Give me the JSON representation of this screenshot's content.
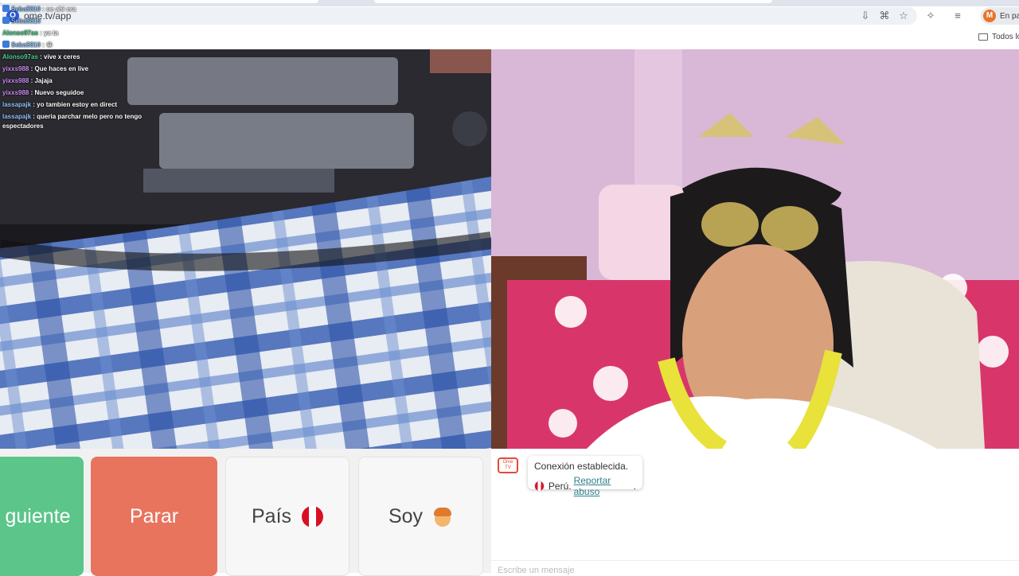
{
  "browser": {
    "url": "ome.tv/app",
    "profile_initial": "M",
    "profile_label": "En pau",
    "bookmarks_all": "Todos lo"
  },
  "stream_chat": [
    {
      "user": "Seba5810",
      "text": "oe ahi era",
      "user_color": "#5aa9ff"
    },
    {
      "user": "Seba5810",
      "text": "",
      "user_color": "#5aa9ff"
    },
    {
      "user": "Alonso97as",
      "text": "ya ta",
      "user_color": "#4fd38b"
    },
    {
      "user": "Seba5810",
      "text": "",
      "user_color": "#5aa9ff"
    },
    {
      "user": "Alonso97as",
      "text": "vive x ceres",
      "user_color": "#4fd38b"
    },
    {
      "user": "yixxs988",
      "text": "Que haces en live",
      "user_color": "#d18cf5"
    },
    {
      "user": "yixxs988",
      "text": "Jajaja",
      "user_color": "#d18cf5"
    },
    {
      "user": "yixxs988",
      "text": "Nuevo seguidoe",
      "user_color": "#d18cf5"
    },
    {
      "user": "lassapajk",
      "text": "yo tambien estoy en direct",
      "user_color": "#5aa9ff"
    },
    {
      "user": "lassapajk",
      "text": "queria parchar melo pero no tengo espectadores",
      "user_color": "#5aa9ff"
    }
  ],
  "controls": {
    "next_label": "guiente",
    "stop_label": "Parar",
    "country_label": "País",
    "me_label": "Soy"
  },
  "system_message": {
    "status": "Conexión establecida.",
    "country": "Perú.",
    "report_link": "Reportar abuso",
    "logo_text": "Ome TV"
  },
  "message_input": {
    "placeholder": "Escribe un mensaje"
  },
  "colors": {
    "next": "#5cc58a",
    "stop": "#e8745e",
    "link": "#2f7f8f"
  }
}
